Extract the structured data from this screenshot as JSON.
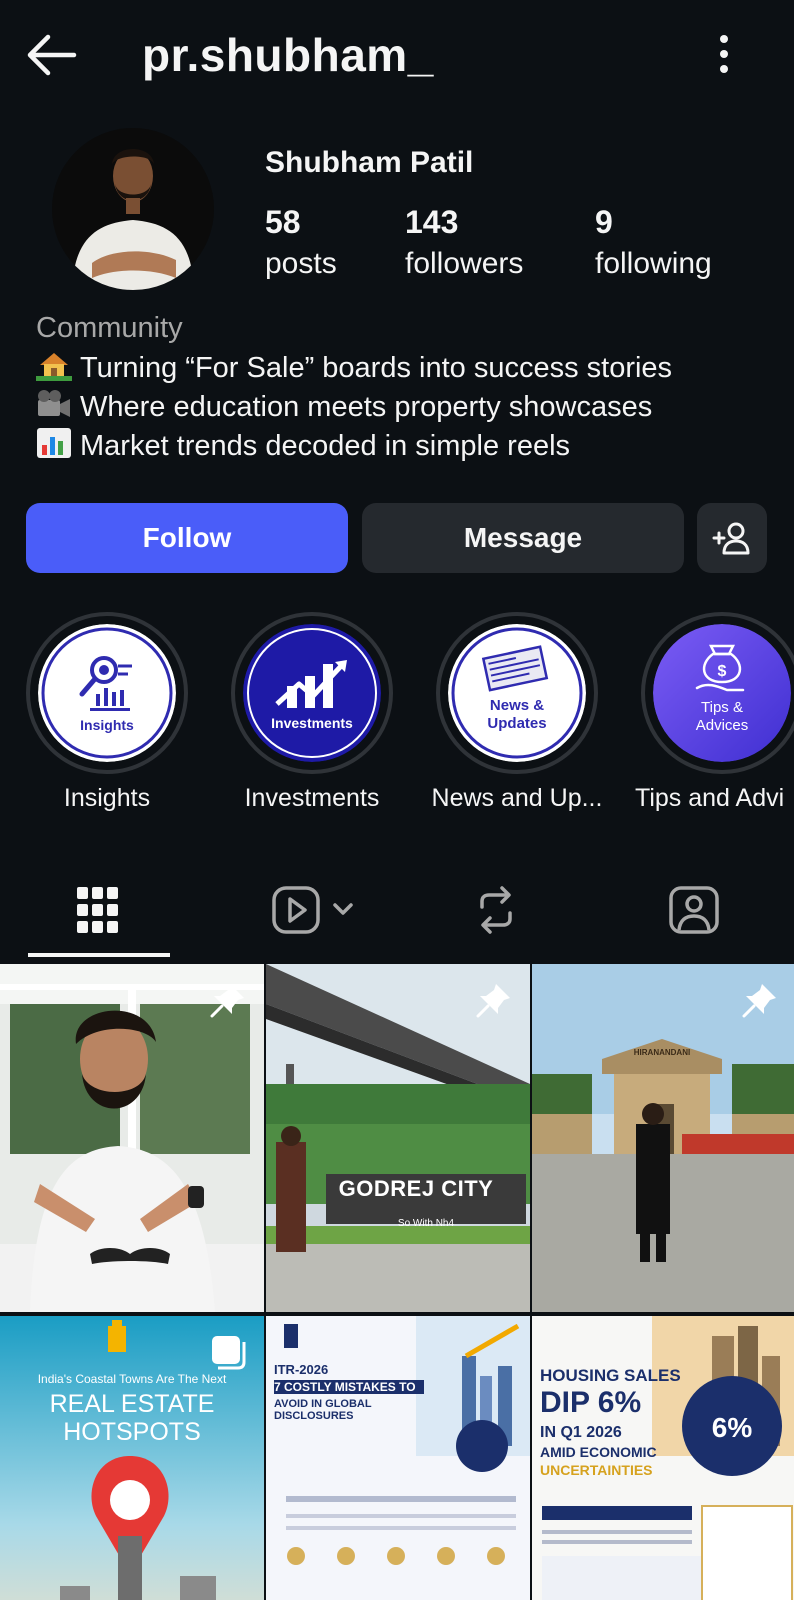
{
  "header": {
    "username": "pr.shubham_"
  },
  "profile": {
    "display_name": "Shubham Patil",
    "stats": {
      "posts": {
        "count": "58",
        "label": "posts"
      },
      "followers": {
        "count": "143",
        "label": "followers"
      },
      "following": {
        "count": "9",
        "label": "following"
      }
    },
    "category": "Community",
    "bio": [
      {
        "emoji": "house-icon",
        "text": "Turning “For Sale” boards into success stories"
      },
      {
        "emoji": "camera-icon",
        "text": "Where education meets property showcases"
      },
      {
        "emoji": "bar-chart-icon",
        "text": "Market trends decoded in simple reels"
      }
    ]
  },
  "actions": {
    "follow_label": "Follow",
    "message_label": "Message"
  },
  "highlights": [
    {
      "label": "Insights",
      "cover_text": "Insights"
    },
    {
      "label": "Investments",
      "cover_text": "Investments"
    },
    {
      "label": "News and Up...",
      "cover_text": "News & Updates"
    },
    {
      "label": "Tips and Advi",
      "cover_text": "Tips & Advices"
    }
  ],
  "tabs": [
    "grid-icon",
    "reels-icon",
    "reposts-icon",
    "tagged-icon"
  ],
  "posts": [
    {
      "type": "video",
      "pinned": true
    },
    {
      "type": "photo",
      "pinned": true,
      "text": "GODREJ CITY",
      "sub": "So With Nh4"
    },
    {
      "type": "photo",
      "pinned": true,
      "text": "HIRANANDANI"
    },
    {
      "type": "carousel",
      "pinned": false,
      "line1": "India's Coastal Towns Are The Next",
      "line2": "REAL ESTATE",
      "line3": "HOTSPOTS"
    },
    {
      "type": "photo",
      "pinned": false,
      "line1": "ITR-2026 DISCLOSURES",
      "line2": "7 COSTLY MISTAKES TO",
      "line3": "AVOID IN GLOBAL DISCLOSURES"
    },
    {
      "type": "photo",
      "pinned": false,
      "line1": "HOUSING SALES",
      "line2": "DIP 6%",
      "line3": "IN Q1 2026",
      "line4": "AMID ECONOMIC",
      "line5": "UNCERTAINTIES",
      "badge": "6%"
    }
  ],
  "colors": {
    "background": "#0c1014",
    "follow_button": "#4a5df9",
    "secondary_button": "#25292e",
    "muted_text": "#a8a8a8"
  }
}
